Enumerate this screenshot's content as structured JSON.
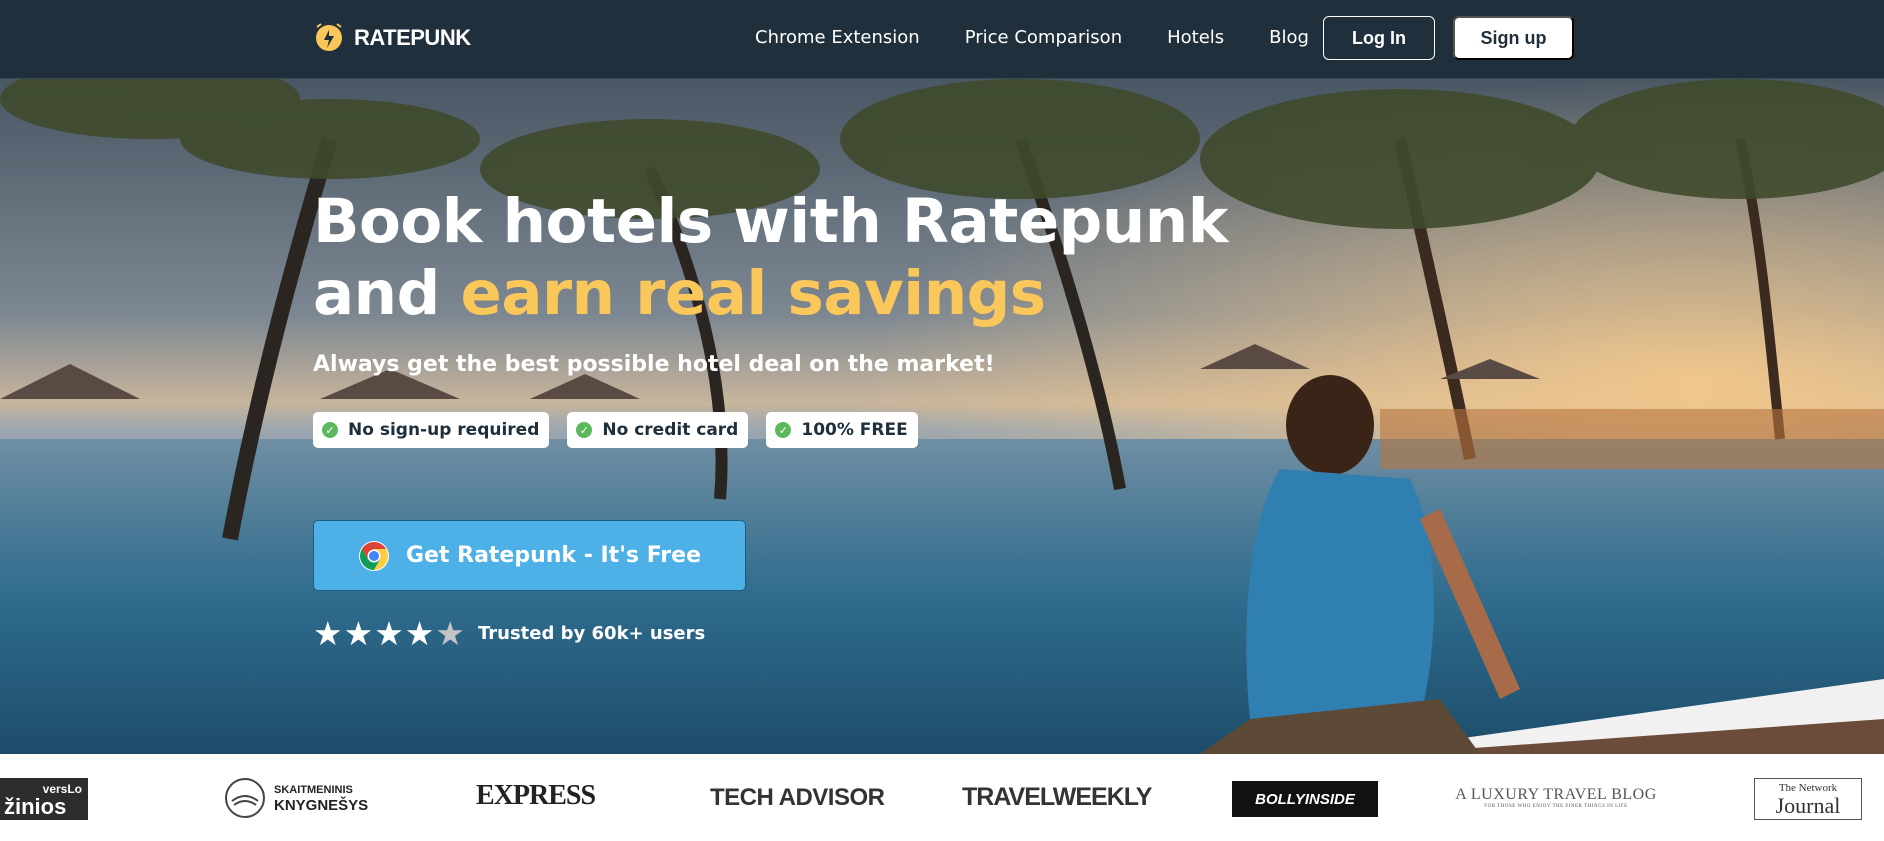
{
  "nav": {
    "brand": "RATEPUNK",
    "links": [
      "Chrome Extension",
      "Price Comparison",
      "Hotels",
      "Blog"
    ],
    "login_label": "Log In",
    "signup_label": "Sign up"
  },
  "hero": {
    "headline_line1": "Book hotels with Ratepunk",
    "headline_line2_prefix": "and ",
    "headline_line2_accent": "earn real savings",
    "subheadline": "Always get the best possible hotel deal on the market!",
    "badges": [
      "No sign-up required",
      "No credit card",
      "100% FREE"
    ],
    "cta_label": "Get Ratepunk - It's Free",
    "rating_stars": 4,
    "rating_max": 5,
    "trusted_text": "Trusted by 60k+ users"
  },
  "press": {
    "logos": [
      {
        "line1": "versLo",
        "line2": "žinios"
      },
      {
        "line1": "SKAITMENINIS",
        "line2": "KNYGNEŠYS"
      },
      {
        "text": "EXPRESS"
      },
      {
        "text": "TECH ADVISOR"
      },
      {
        "text": "TRAVELWEEKLY"
      },
      {
        "text": "BOLLYINSIDE"
      },
      {
        "line1": "A LUXURY TRAVEL BLOG",
        "line2": "FOR THOSE WHO ENJOY THE FINER THINGS IN LIFE"
      },
      {
        "line1": "The Network",
        "line2": "Journal"
      }
    ]
  },
  "colors": {
    "nav_bg": "#1f2f3b",
    "accent_yellow": "#fac75a",
    "cta_blue": "#4db0e6",
    "check_green": "#5cb85c"
  },
  "icons": [
    "ratepunk-logo-icon",
    "check-icon",
    "chrome-icon",
    "star-icon"
  ]
}
